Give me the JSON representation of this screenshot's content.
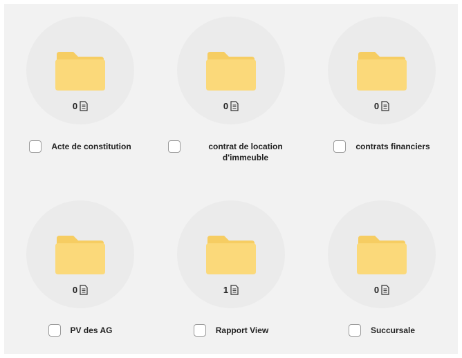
{
  "folders": [
    {
      "name": "Acte de constitution",
      "count": "0"
    },
    {
      "name": "contrat de location d'immeuble",
      "count": "0"
    },
    {
      "name": "contrats financiers",
      "count": "0"
    },
    {
      "name": "PV des AG",
      "count": "0"
    },
    {
      "name": "Rapport View",
      "count": "1"
    },
    {
      "name": "Succursale",
      "count": "0"
    }
  ],
  "colors": {
    "background": "#f2f2f2",
    "circle": "#ebebeb",
    "folder_back": "#f6cd62",
    "folder_front": "#fbd97a"
  },
  "icons": {
    "folder": "folder-icon",
    "document": "document-icon"
  }
}
